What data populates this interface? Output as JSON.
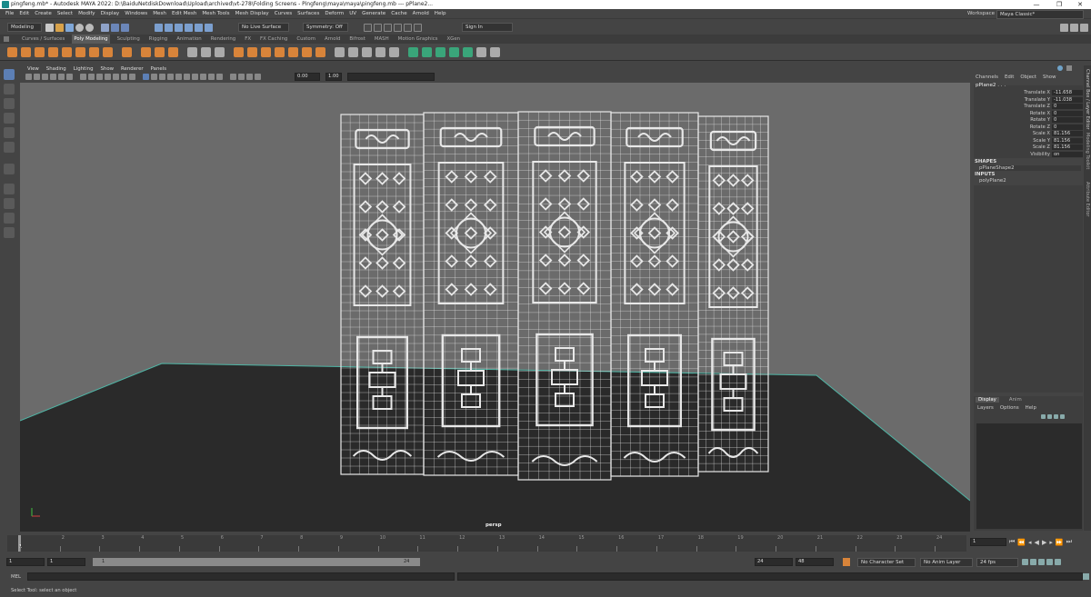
{
  "window": {
    "title": "pingfeng.mb* - Autodesk MAYA 2022: D:\\BaiduNetdiskDownload\\Upload\\archived\\vt-278\\Folding Screens - Pingfeng\\maya\\maya\\pingfeng.mb  ---  pPlane2...",
    "controls": [
      "—",
      "❐",
      "✕"
    ]
  },
  "menubar": {
    "items": [
      "File",
      "Edit",
      "Create",
      "Select",
      "Modify",
      "Display",
      "Windows",
      "Mesh",
      "Edit Mesh",
      "Mesh Tools",
      "Mesh Display",
      "Curves",
      "Surfaces",
      "Deform",
      "UV",
      "Generate",
      "Cache",
      "Arnold",
      "Help"
    ],
    "workspace_label": "Workspace :",
    "workspace_value": "Maya Classic*"
  },
  "statusline": {
    "mode": "Modeling",
    "live_surface": "No Live Surface",
    "symmetry": "Symmetry: Off",
    "sign_in": "Sign In"
  },
  "shelf": {
    "tabs": [
      "Curves / Surfaces",
      "Poly Modeling",
      "Sculpting",
      "Rigging",
      "Animation",
      "Rendering",
      "FX",
      "FX Caching",
      "Custom",
      "Arnold",
      "Bifrost",
      "MASH",
      "Motion Graphics",
      "XGen"
    ],
    "active_tab": "Poly Modeling"
  },
  "viewport": {
    "menu": [
      "View",
      "Shading",
      "Lighting",
      "Show",
      "Renderer",
      "Panels"
    ],
    "near": "0.00",
    "far": "1.00",
    "camera_label": "persp",
    "logo": "M",
    "colors": {
      "background": "#6b6b6b",
      "floor": "#2a2a2a",
      "wire": "#e8e8e8",
      "floor_edge": "#4fb5a5"
    }
  },
  "channelbox": {
    "menu": [
      "Channels",
      "Edit",
      "Object",
      "Show"
    ],
    "object_name": "pPlane2 . . .",
    "channels": [
      {
        "label": "Translate X",
        "value": "-11.658"
      },
      {
        "label": "Translate Y",
        "value": "-11.038"
      },
      {
        "label": "Translate Z",
        "value": "0"
      },
      {
        "label": "Rotate X",
        "value": "0"
      },
      {
        "label": "Rotate Y",
        "value": "0"
      },
      {
        "label": "Rotate Z",
        "value": "0"
      },
      {
        "label": "Scale X",
        "value": "81.156"
      },
      {
        "label": "Scale Y",
        "value": "81.156"
      },
      {
        "label": "Scale Z",
        "value": "81.156"
      },
      {
        "label": "Visibility",
        "value": "on"
      }
    ],
    "shapes_header": "SHAPES",
    "shape_name": "pPlaneShape2",
    "inputs_header": "INPUTS",
    "input_name": "polyPlane2"
  },
  "layers": {
    "tabs": [
      "Display",
      "Anim"
    ],
    "menu": [
      "Layers",
      "Options",
      "Help"
    ]
  },
  "side_tabs": [
    "Channel Box / Layer Editor",
    "Modeling Toolkit",
    "Attribute Editor"
  ],
  "timeslider": {
    "ticks": [
      "1",
      "2",
      "3",
      "4",
      "5",
      "6",
      "7",
      "8",
      "9",
      "10",
      "11",
      "12",
      "13",
      "14",
      "15",
      "16",
      "17",
      "18",
      "19",
      "20",
      "21",
      "22",
      "23",
      "24"
    ],
    "current_frame": "1",
    "current_field": "1"
  },
  "rangebar": {
    "start": "1",
    "start2": "1",
    "range_start_label": "1",
    "range_end_label": "24",
    "end": "24",
    "end2": "48",
    "character_set": "No Character Set",
    "anim_layer": "No Anim Layer",
    "fps": "24 fps"
  },
  "cmdline": {
    "label": "MEL"
  },
  "helpline": {
    "text": "Select Tool: select an object"
  }
}
